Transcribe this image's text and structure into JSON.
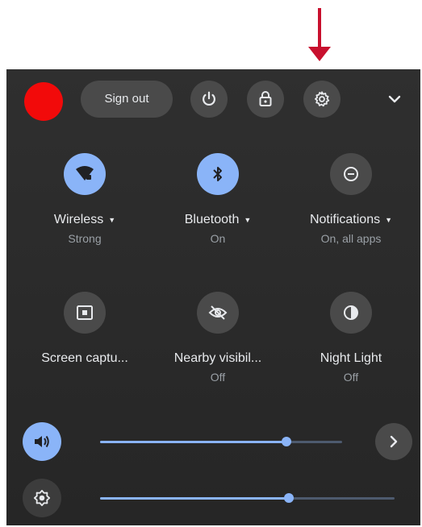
{
  "colors": {
    "panel_bg": "#2c2c2c",
    "accent": "#8ab4f8",
    "avatar": "#f20a0a",
    "annotation_arrow": "#c8102e"
  },
  "header": {
    "avatar_icon": "user-avatar",
    "sign_out_label": "Sign out",
    "power_icon": "power-icon",
    "lock_icon": "lock-icon",
    "settings_icon": "gear-icon",
    "collapse_icon": "chevron-down-icon"
  },
  "tiles": [
    {
      "label": "Wireless",
      "sub": "Strong",
      "icon": "wifi-icon",
      "active": true,
      "has_menu": true
    },
    {
      "label": "Bluetooth",
      "sub": "On",
      "icon": "bluetooth-icon",
      "active": true,
      "has_menu": true
    },
    {
      "label": "Notifications",
      "sub": "On, all apps",
      "icon": "do-not-disturb-icon",
      "active": false,
      "has_menu": true
    },
    {
      "label": "Screen captu...",
      "sub": "",
      "icon": "screen-capture-icon",
      "active": false,
      "has_menu": false
    },
    {
      "label": "Nearby visibil...",
      "sub": "Off",
      "icon": "visibility-off-icon",
      "active": false,
      "has_menu": false
    },
    {
      "label": "Night Light",
      "sub": "Off",
      "icon": "night-light-icon",
      "active": false,
      "has_menu": false
    }
  ],
  "sliders": {
    "volume": {
      "icon": "volume-icon",
      "level_percent": 77
    },
    "brightness": {
      "icon": "brightness-icon",
      "level_percent": 64
    },
    "audio_settings_icon": "chevron-right-icon"
  }
}
